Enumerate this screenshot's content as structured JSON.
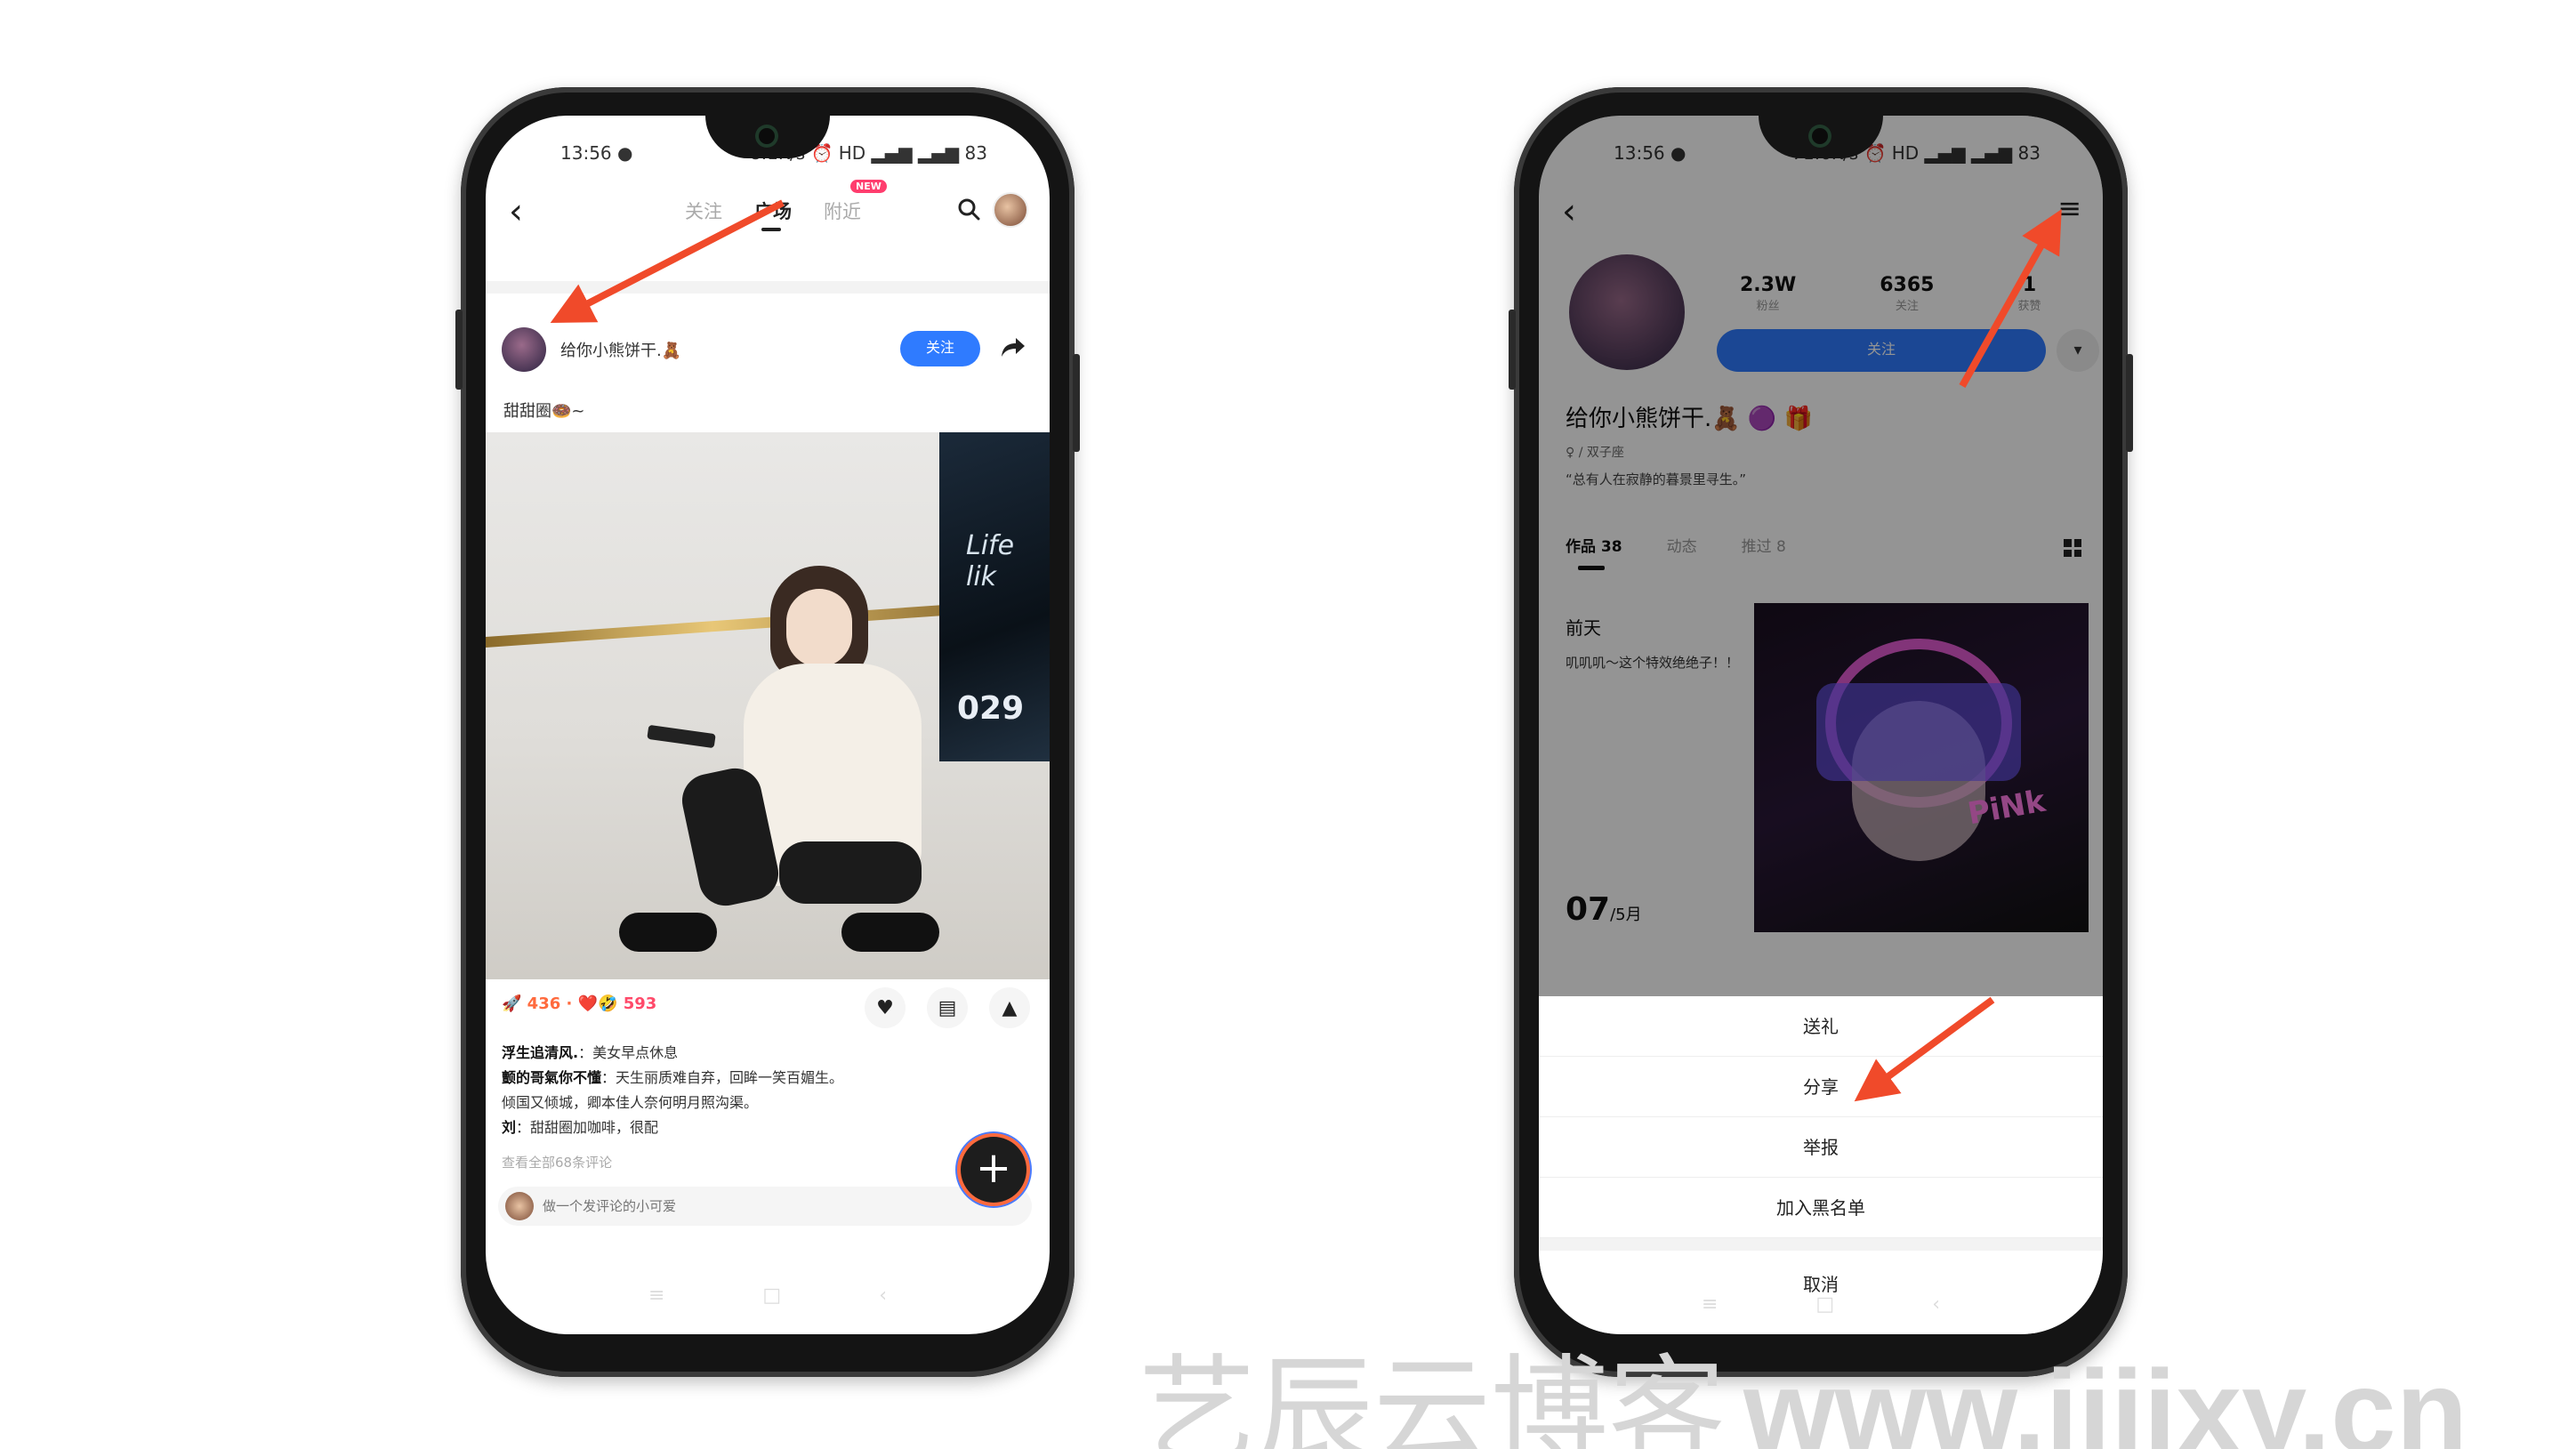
{
  "left_phone": {
    "status": {
      "time": "13:56",
      "dot": "●",
      "right": "8.1K/s ⏰ HD ▂▄▆ ▂▄▆ 83"
    },
    "tabs": [
      "关注",
      "广场",
      "附近"
    ],
    "new_badge": "NEW",
    "post": {
      "author": "给你小熊饼干.🧸",
      "follow_label": "关注",
      "caption": "甜甜圈🍩~",
      "photo_poster_text": "Life lik",
      "photo_poster_num": "029"
    },
    "stats": {
      "rockets": "🚀 436 ·",
      "hearts": "❤️🤣 593"
    },
    "comments": [
      {
        "user": "浮生追清风.",
        "text": "美女早点休息"
      },
      {
        "user": "颤的哥氣你不懂",
        "text": "天生丽质难自弃，回眸一笑百媚生。"
      },
      {
        "user": "",
        "text": "倾国又倾城，卿本佳人奈何明月照沟渠。"
      },
      {
        "user": "刘",
        "text": "甜甜圈加咖啡，很配"
      }
    ],
    "view_all": "查看全部68条评论",
    "comment_placeholder": "做一个发评论的小可爱",
    "fab_label": "+",
    "nav": [
      "≡",
      "□",
      "‹"
    ]
  },
  "right_phone": {
    "status": {
      "time": "13:56",
      "dot": "●",
      "right": "71.6K/s ⏰ HD ▂▄▆ ▂▄▆ 83"
    },
    "stats": [
      {
        "num": "2.3W",
        "label": "粉丝"
      },
      {
        "num": "6365",
        "label": "关注"
      },
      {
        "num": "1",
        "label": "获赞"
      }
    ],
    "follow_label": "关注",
    "dropdown": "▾",
    "name": "给你小熊饼干.🧸 🟣 🎁",
    "tag": "♀ / 双子座",
    "bio": "“总有人在寂静的暮景里寻生。”",
    "tabs": [
      "作品 38",
      "动态",
      "推过 8"
    ],
    "work": {
      "title": "前天",
      "desc": "叽叽叽～这个特效绝绝子！！",
      "day": "07",
      "month": "/5月",
      "thumb_text": "PiNk"
    },
    "sheet": {
      "items": [
        "送礼",
        "分享",
        "举报",
        "加入黑名单"
      ],
      "cancel": "取消"
    },
    "nav": [
      "≡",
      "□",
      "‹"
    ]
  },
  "watermark": {
    "cn": "艺辰云博客",
    "url": "www.iiiixy.cn"
  },
  "colors": {
    "accent": "#2f7bff",
    "arrow": "#f04a2a",
    "badge": "#ff3d6e"
  }
}
